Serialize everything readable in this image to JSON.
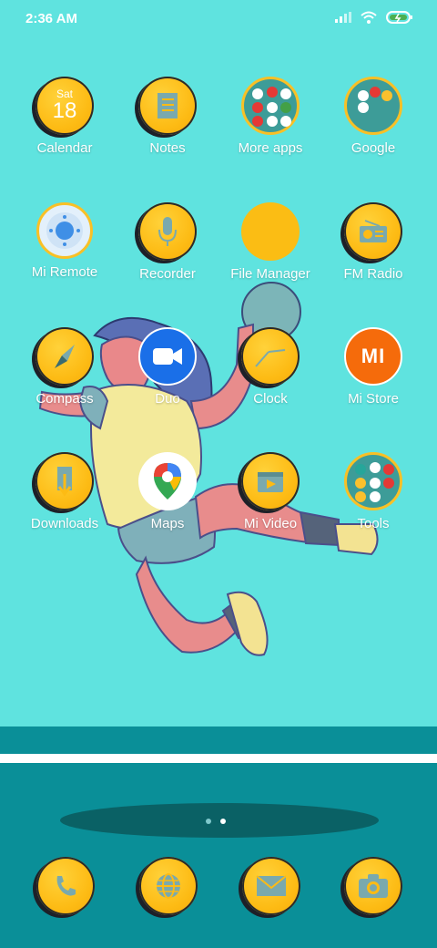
{
  "status_bar": {
    "time": "2:36 AM",
    "icons": [
      "signal-icon",
      "wifi-icon",
      "battery-charging-icon"
    ]
  },
  "colors": {
    "background": "#5fe3df",
    "coin": "#fdbb14",
    "dock": "#0a8f98",
    "folder": "#3d9c98",
    "mi_store": "#f56b0b"
  },
  "calendar": {
    "weekday": "Sat",
    "day": "18"
  },
  "apps": [
    {
      "label": "Calendar",
      "icon": "calendar-icon"
    },
    {
      "label": "Notes",
      "icon": "notes-icon"
    },
    {
      "label": "More apps",
      "icon": "folder-icon"
    },
    {
      "label": "Google",
      "icon": "folder-icon"
    },
    {
      "label": "Mi Remote",
      "icon": "remote-icon"
    },
    {
      "label": "Recorder",
      "icon": "microphone-icon"
    },
    {
      "label": "File Manager",
      "icon": "file-manager-icon"
    },
    {
      "label": "FM Radio",
      "icon": "radio-icon"
    },
    {
      "label": "Compass",
      "icon": "compass-icon"
    },
    {
      "label": "Duo",
      "icon": "video-camera-icon"
    },
    {
      "label": "Clock",
      "icon": "clock-icon"
    },
    {
      "label": "Mi Store",
      "icon": "mi-logo-icon",
      "logo_text": "MI"
    },
    {
      "label": "Downloads",
      "icon": "download-icon"
    },
    {
      "label": "Maps",
      "icon": "map-pin-icon"
    },
    {
      "label": "Mi Video",
      "icon": "video-icon"
    },
    {
      "label": "Tools",
      "icon": "folder-icon"
    }
  ],
  "page_indicator": {
    "count": 2,
    "active": 2
  },
  "dock": [
    {
      "name": "phone",
      "icon": "phone-icon"
    },
    {
      "name": "browser",
      "icon": "globe-icon"
    },
    {
      "name": "messages",
      "icon": "envelope-icon"
    },
    {
      "name": "camera",
      "icon": "camera-icon"
    }
  ]
}
